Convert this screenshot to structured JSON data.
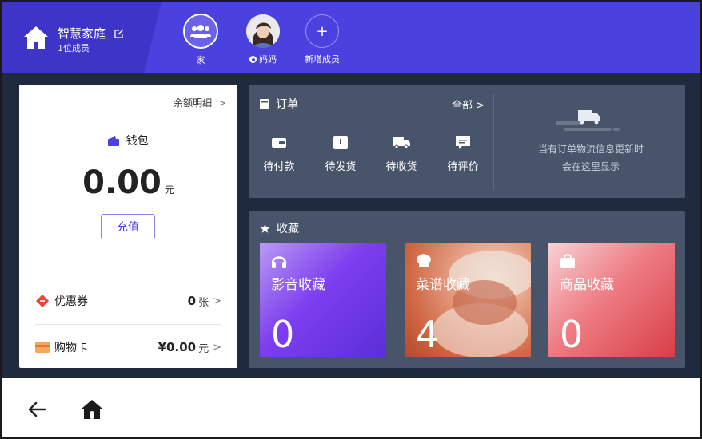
{
  "header": {
    "family_name": "智慧家庭",
    "member_count": "1位成员",
    "members": [
      {
        "label": "家"
      },
      {
        "label": "妈妈"
      },
      {
        "label": "新增成员",
        "icon_text": "+"
      }
    ]
  },
  "wallet": {
    "balance_detail": "余额明细",
    "title": "钱包",
    "balance": "0.00",
    "unit": "元",
    "recharge": "充值",
    "coupon": {
      "label": "优惠券",
      "value": "0",
      "unit": "张"
    },
    "shopping_card": {
      "label": "购物卡",
      "value": "¥0.00",
      "unit": "元"
    },
    "chevron": ">"
  },
  "orders": {
    "title": "订单",
    "all": "全部 >",
    "items": [
      {
        "label": "待付款",
        "icon": "wallet-icon"
      },
      {
        "label": "待发货",
        "icon": "box-icon"
      },
      {
        "label": "待收货",
        "icon": "truck-icon"
      },
      {
        "label": "待评价",
        "icon": "comment-icon"
      }
    ],
    "hint_line1": "当有订单物流信息更新时",
    "hint_line2": "会在这里显示"
  },
  "favorites": {
    "title": "收藏",
    "cards": [
      {
        "name": "影音收藏",
        "count": "0",
        "icon": "headphones-icon"
      },
      {
        "name": "菜谱收藏",
        "count": "4",
        "icon": "chef-hat-icon"
      },
      {
        "name": "商品收藏",
        "count": "0",
        "icon": "bag-icon"
      }
    ]
  },
  "colors": {
    "header_bg": "#4a41de",
    "main_bg": "#1f2a3e",
    "panel_bg": "#48546a",
    "accent": "#4a41de"
  }
}
